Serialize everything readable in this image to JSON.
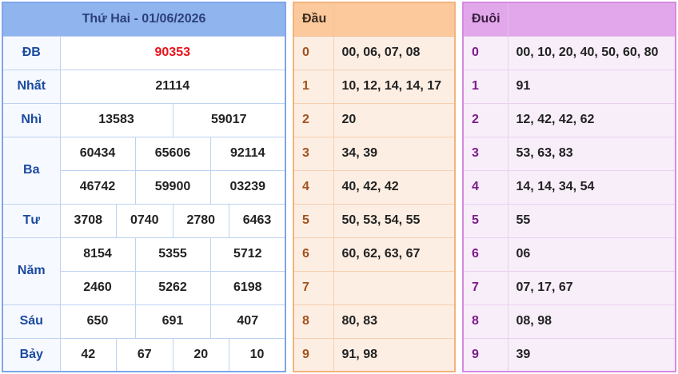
{
  "results": {
    "title": "Thứ Hai - 01/06/2026",
    "prizes": {
      "db": {
        "label": "ĐB",
        "numbers": [
          "90353"
        ]
      },
      "nhat": {
        "label": "Nhất",
        "numbers": [
          "21114"
        ]
      },
      "nhi": {
        "label": "Nhì",
        "numbers": [
          "13583",
          "59017"
        ]
      },
      "ba": {
        "label": "Ba",
        "numbers": [
          "60434",
          "65606",
          "92114",
          "46742",
          "59900",
          "03239"
        ]
      },
      "tu": {
        "label": "Tư",
        "numbers": [
          "3708",
          "0740",
          "2780",
          "6463"
        ]
      },
      "nam": {
        "label": "Năm",
        "numbers": [
          "8154",
          "5355",
          "5712",
          "2460",
          "5262",
          "6198"
        ]
      },
      "sau": {
        "label": "Sáu",
        "numbers": [
          "650",
          "691",
          "407"
        ]
      },
      "bay": {
        "label": "Bảy",
        "numbers": [
          "42",
          "67",
          "20",
          "10"
        ]
      }
    },
    "colors": {
      "header_bg": "#90b4ee",
      "label": "#1a4aa0",
      "special": "#e8121b"
    }
  },
  "dau": {
    "header": "Đầu",
    "rows": [
      {
        "digit": "0",
        "values": "00, 06, 07, 08"
      },
      {
        "digit": "1",
        "values": "10, 12, 14, 14, 17"
      },
      {
        "digit": "2",
        "values": "20"
      },
      {
        "digit": "3",
        "values": "34, 39"
      },
      {
        "digit": "4",
        "values": "40, 42, 42"
      },
      {
        "digit": "5",
        "values": "50, 53, 54, 55"
      },
      {
        "digit": "6",
        "values": "60, 62, 63, 67"
      },
      {
        "digit": "7",
        "values": ""
      },
      {
        "digit": "8",
        "values": "80, 83"
      },
      {
        "digit": "9",
        "values": "91, 98"
      }
    ],
    "colors": {
      "header_bg": "#fbc99b",
      "body_bg": "#fdeee3"
    }
  },
  "duoi": {
    "header": "Đuôi",
    "rows": [
      {
        "digit": "0",
        "values": "00, 10, 20, 40, 50, 60, 80"
      },
      {
        "digit": "1",
        "values": "91"
      },
      {
        "digit": "2",
        "values": "12, 42, 42, 62"
      },
      {
        "digit": "3",
        "values": "53, 63, 83"
      },
      {
        "digit": "4",
        "values": "14, 14, 34, 54"
      },
      {
        "digit": "5",
        "values": "55"
      },
      {
        "digit": "6",
        "values": "06"
      },
      {
        "digit": "7",
        "values": "07, 17, 67"
      },
      {
        "digit": "8",
        "values": "08, 98"
      },
      {
        "digit": "9",
        "values": "39"
      }
    ],
    "colors": {
      "header_bg": "#e2a7ea",
      "body_bg": "#f8eefa"
    }
  }
}
